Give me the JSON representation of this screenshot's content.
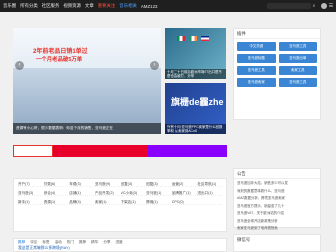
{
  "nav": {
    "items": [
      "音乐圈",
      "所有分类",
      "社区服务",
      "视频资源",
      "文章",
      "重要关注",
      "音乐相关",
      "AMZ123"
    ]
  },
  "search": {
    "placeholder": ""
  },
  "hero": {
    "text1": "2年前老品日销1单过",
    "text2": "一个月老品破5万单",
    "caption": "资源号小心肝，很少数据表明：你这个月的销售，亚马逊正在",
    "prev": "‹",
    "next": "›"
  },
  "thumbs": [
    {
      "caption": "十月二十日前后欧洲市场/IT出口是不是也会被打，分享"
    },
    {
      "title": "旗栅de霾zhe",
      "caption": "外贸十问:亚马逊PPC卖家是什么回报率和 从卖家到ACoS"
    }
  ],
  "sidebar": {
    "title": "插件",
    "tools": [
      "中文关键",
      "亚马逊工具",
      "亚马逊标题",
      "亚马逊出单",
      "亚马逊工具",
      "卖家工具",
      "亚马逊卖家",
      "亚马逊工具"
    ]
  },
  "tags": [
    "开户(7)",
    "付费(6)",
    "年费(3)",
    "亚马逊(9)",
    "回复(3)",
    "回复(3)",
    "运营(2)",
    "社区导航(1)",
    "亚马逊(3)",
    "综合(4)",
    "店铺(1)",
    "产品开发(2)",
    "VC小卖(3)",
    "亚马逊(1)",
    "品牌推广(1)",
    "进出口(1)",
    "新手(1)",
    "资源(1)",
    "品牌(4)",
    "卖家(1)",
    "下架店(1)",
    "跨境(1)",
    "CPC(0)",
    ""
  ],
  "tabs": [
    "推荐",
    "评论",
    "标签",
    "活动",
    "热门",
    "推荐",
    "精华",
    "分享",
    "进度"
  ],
  "post": "我这是正常嘛那么多跨境(RAY)",
  "notice": {
    "title": "公告",
    "items": [
      "亚马逊加拿大站，销售多少可以发",
      "深刻的数据意味着什么，亚马逊",
      "AMZ数据分析，跨境亚马逊卖家",
      "亚马逊官方提示，销量涨了几十",
      "亚马逊VAT，关于欧洲站的介绍",
      "亚马逊全球开店新政策分析",
      "卖家亚马逊到了电商很快卖"
    ]
  },
  "wechat": {
    "title": "微信号"
  },
  "colors": {
    "topbar": "#1f1f1f",
    "accent": "#3b86d4",
    "hot": "#ff4b3a"
  },
  "icons": {
    "search": "search-icon",
    "user": "user-icon",
    "menu": "menu-icon"
  }
}
